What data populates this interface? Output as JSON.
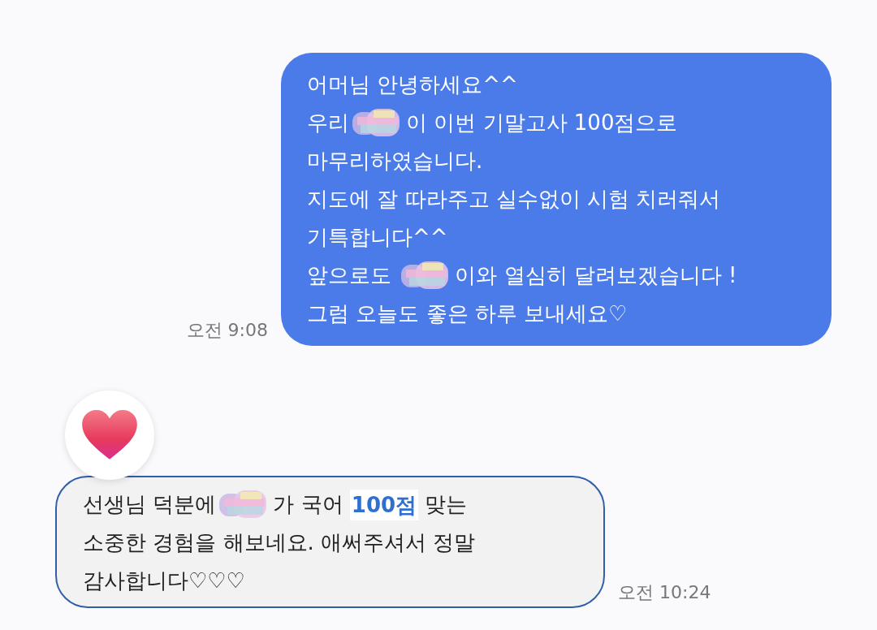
{
  "messages": [
    {
      "kind": "sent",
      "time": "오전 9:08",
      "lines": [
        [
          {
            "kind": "text",
            "text": "어머님 안녕하세요^^"
          }
        ],
        [
          {
            "kind": "text",
            "text": "우리"
          },
          {
            "kind": "redaction"
          },
          {
            "kind": "text",
            "text": "이 이번 기말고사 100점으로"
          }
        ],
        [
          {
            "kind": "text",
            "text": "마무리하였습니다."
          }
        ],
        [
          {
            "kind": "text",
            "text": "지도에 잘 따라주고 실수없이 시험 치러줘서"
          }
        ],
        [
          {
            "kind": "text",
            "text": "기특합니다^^"
          }
        ],
        [
          {
            "kind": "text",
            "text": "앞으로도 "
          },
          {
            "kind": "redaction"
          },
          {
            "kind": "text",
            "text": "이와 열심히 달려보겠습니다 !"
          }
        ],
        [
          {
            "kind": "text",
            "text": "그럼 오늘도 좋은 하루 보내세요♡"
          }
        ]
      ]
    },
    {
      "kind": "received",
      "time": "오전 10:24",
      "reacted": true,
      "lines": [
        [
          {
            "kind": "text",
            "text": "선생님 덕분에"
          },
          {
            "kind": "redaction"
          },
          {
            "kind": "text",
            "text": "가 국어 "
          },
          {
            "kind": "highlight",
            "text": "100점"
          },
          {
            "kind": "text",
            "text": " 맞는"
          }
        ],
        [
          {
            "kind": "text",
            "text": "소중한 경험을 해보네요. 애써주셔서 정말"
          }
        ],
        [
          {
            "kind": "text",
            "text": "감사합니다♡♡♡"
          }
        ]
      ]
    }
  ]
}
